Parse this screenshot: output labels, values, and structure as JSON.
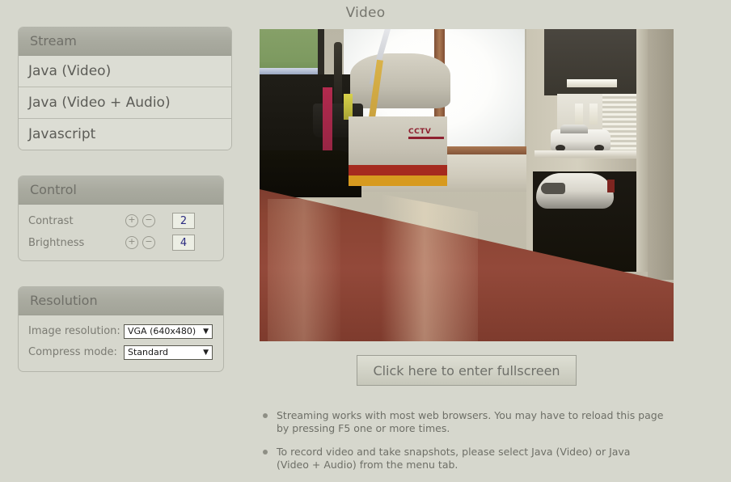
{
  "page": {
    "title": "Video"
  },
  "stream_menu": {
    "header": "Stream",
    "items": [
      {
        "label": "Java (Video)"
      },
      {
        "label": "Java (Video + Audio)"
      },
      {
        "label": "Javascript"
      }
    ]
  },
  "control": {
    "header": "Control",
    "increase_icon": "+",
    "decrease_icon": "−",
    "rows": [
      {
        "label": "Contrast",
        "value": "2"
      },
      {
        "label": "Brightness",
        "value": "4"
      }
    ]
  },
  "resolution": {
    "header": "Resolution",
    "arrow_icon": "▼",
    "rows": [
      {
        "label": "Image resolution:",
        "value": "VGA (640x480)"
      },
      {
        "label": "Compress mode:",
        "value": "Standard"
      }
    ]
  },
  "video": {
    "name": "live-video-stream",
    "overlay_text": "CCTV"
  },
  "fullscreen_button": {
    "label": "Click here to enter fullscreen"
  },
  "notes": [
    {
      "text": "Streaming works with most web browsers. You may have to reload this page by pressing F5 one or more times."
    },
    {
      "text": "To record video and take snapshots, please select Java (Video) or Java (Video + Audio) from the menu tab."
    }
  ],
  "colors": {
    "page_background": "#d6d7cd",
    "panel_header": "#a9aa9f",
    "menu_item": "#dcddd4",
    "label_text": "#7b7b73",
    "input_text": "#2b2b80"
  }
}
